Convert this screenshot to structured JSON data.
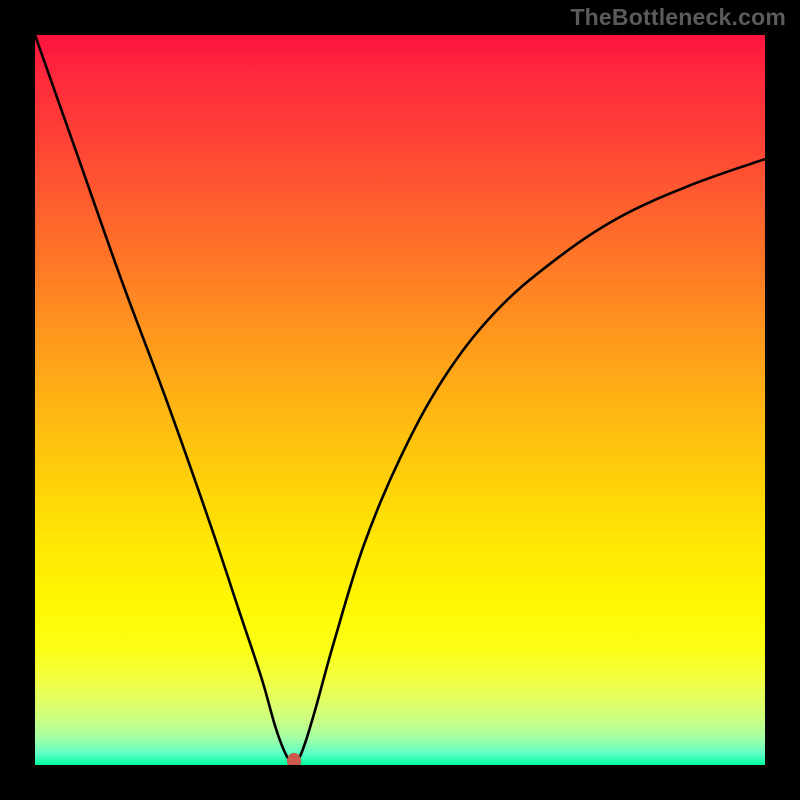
{
  "watermark": "TheBottleneck.com",
  "chart_data": {
    "type": "line",
    "title": "",
    "xlabel": "",
    "ylabel": "",
    "xlim": [
      0,
      100
    ],
    "ylim": [
      0,
      100
    ],
    "grid": false,
    "series": [
      {
        "name": "bottleneck-curve",
        "x": [
          0,
          6,
          12,
          18,
          24,
          28,
          31,
          33,
          34.5,
          35.5,
          36,
          37,
          38.5,
          41,
          45,
          50,
          56,
          63,
          71,
          80,
          90,
          100
        ],
        "values": [
          100,
          83,
          66,
          50,
          33,
          21,
          12,
          5,
          1.2,
          0.5,
          0.6,
          3,
          8,
          17,
          30,
          42,
          53,
          62,
          69,
          75,
          79.5,
          83
        ]
      }
    ],
    "marker": {
      "x": 35.5,
      "y": 0.5,
      "color": "#cf5b4f"
    },
    "background_gradient": {
      "top": "#fe133f",
      "mid": "#ffe804",
      "bottom": "#00ff9c"
    }
  }
}
